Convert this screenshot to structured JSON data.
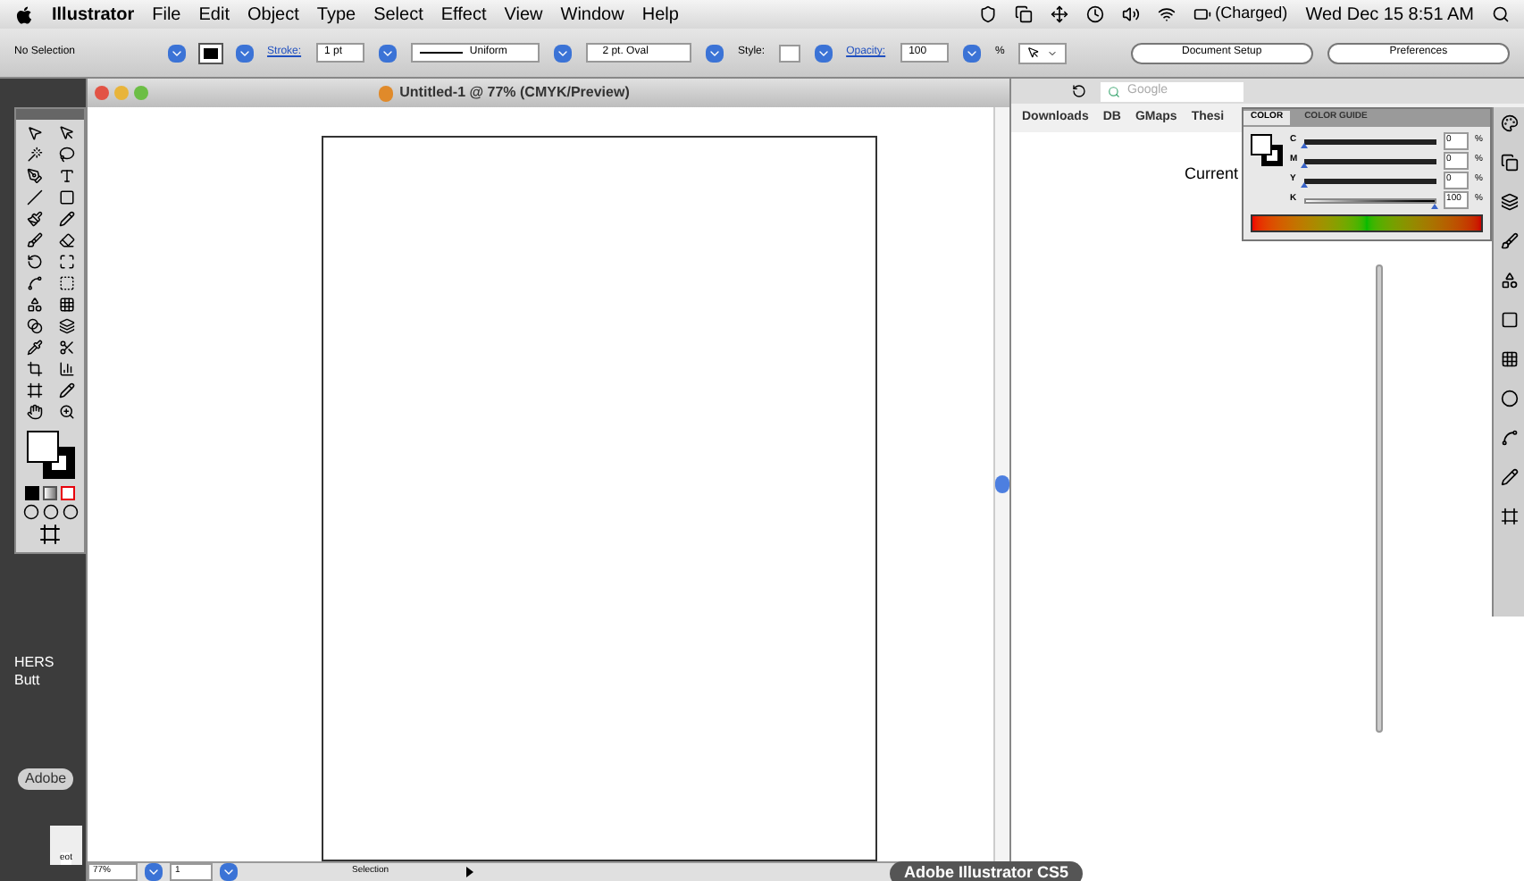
{
  "menu_bar": {
    "app": "Illustrator",
    "items": [
      "File",
      "Edit",
      "Object",
      "Type",
      "Select",
      "Effect",
      "View",
      "Window",
      "Help"
    ],
    "battery": "(Charged)",
    "clock": "Wed Dec 15  8:51 AM"
  },
  "control_bar": {
    "selection": "No Selection",
    "stroke_label": "Stroke:",
    "stroke_weight": "1 pt",
    "profile": "Uniform",
    "brush": "2 pt. Oval",
    "style_label": "Style:",
    "opacity_label": "Opacity:",
    "opacity": "100",
    "percent": "%",
    "buttons": [
      "Document Setup",
      "Preferences"
    ]
  },
  "document": {
    "title": "Untitled-1 @ 77% (CMYK/Preview)",
    "zoom": "77%",
    "page": "1",
    "status": "Selection"
  },
  "browser": {
    "search_placeholder": "Google",
    "bookmarks": [
      "Downloads",
      "DB",
      "GMaps",
      "Thesi"
    ],
    "text": "Current"
  },
  "color_panel": {
    "tabs": [
      {
        "label": "COLOR",
        "selected": true
      },
      {
        "label": "COLOR GUIDE",
        "selected": false
      }
    ],
    "channels": [
      {
        "name": "C",
        "value": "0",
        "level": 0
      },
      {
        "name": "M",
        "value": "0",
        "level": 0
      },
      {
        "name": "Y",
        "value": "0",
        "level": 0
      },
      {
        "name": "K",
        "value": "100",
        "level": 1
      }
    ],
    "unit": "%"
  },
  "desktop": {
    "labels": [
      "HERS",
      "Butt"
    ],
    "pill": "Adobe",
    "file": "eot"
  },
  "dock_tooltip": "Adobe Illustrator CS5"
}
